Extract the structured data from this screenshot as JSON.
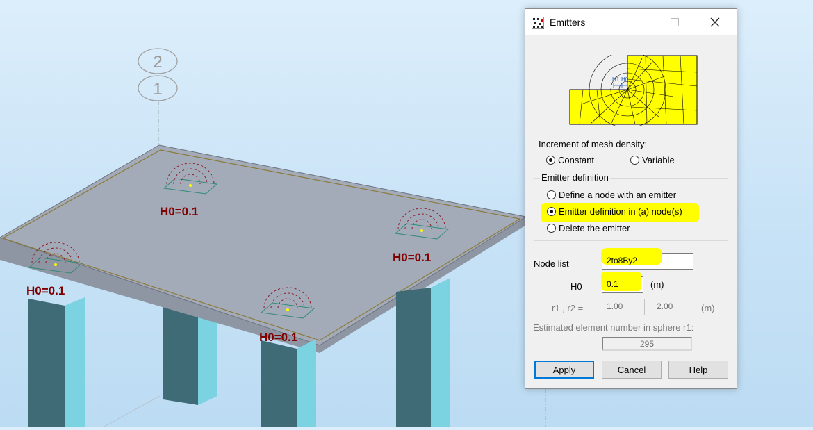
{
  "scene": {
    "node_labels": [
      "2",
      "1"
    ],
    "emitter_labels": [
      "H0=0.1",
      "H0=0.1",
      "H0=0.1",
      "H0=0.1"
    ],
    "colors": {
      "slab": "#a3aab6",
      "column_dark": "#406d78",
      "column_light": "#79d3e2",
      "label": "#800000"
    }
  },
  "dialog": {
    "title": "Emitters",
    "icons": {
      "app": "mesh-app-icon",
      "maximize": "maximize-icon",
      "close": "close-icon"
    },
    "preview": {
      "h1": "H1",
      "h0": "H0"
    },
    "increment_label": "Increment of mesh density:",
    "increment_options": {
      "constant": "Constant",
      "variable": "Variable",
      "selected": "Constant"
    },
    "emitter_definition_title": "Emitter definition",
    "emitter_options": {
      "define_node": "Define a node with an emitter",
      "in_nodes": "Emitter definition in (a) node(s)",
      "delete": "Delete the emitter",
      "selected": "Emitter definition in (a) node(s)"
    },
    "node_list_label": "Node list",
    "node_list_value": "2to8By2",
    "h0_label": "H0 =",
    "h0_value": "0.1",
    "h0_unit": "(m)",
    "r_label": "r1 , r2  =",
    "r1_value": "1.00",
    "r2_value": "2.00",
    "r_unit": "(m)",
    "estimated_label": "Estimated element number in sphere r1:",
    "estimated_value": "295",
    "buttons": {
      "apply": "Apply",
      "cancel": "Cancel",
      "help": "Help"
    },
    "highlight_color": "#ffff00"
  }
}
